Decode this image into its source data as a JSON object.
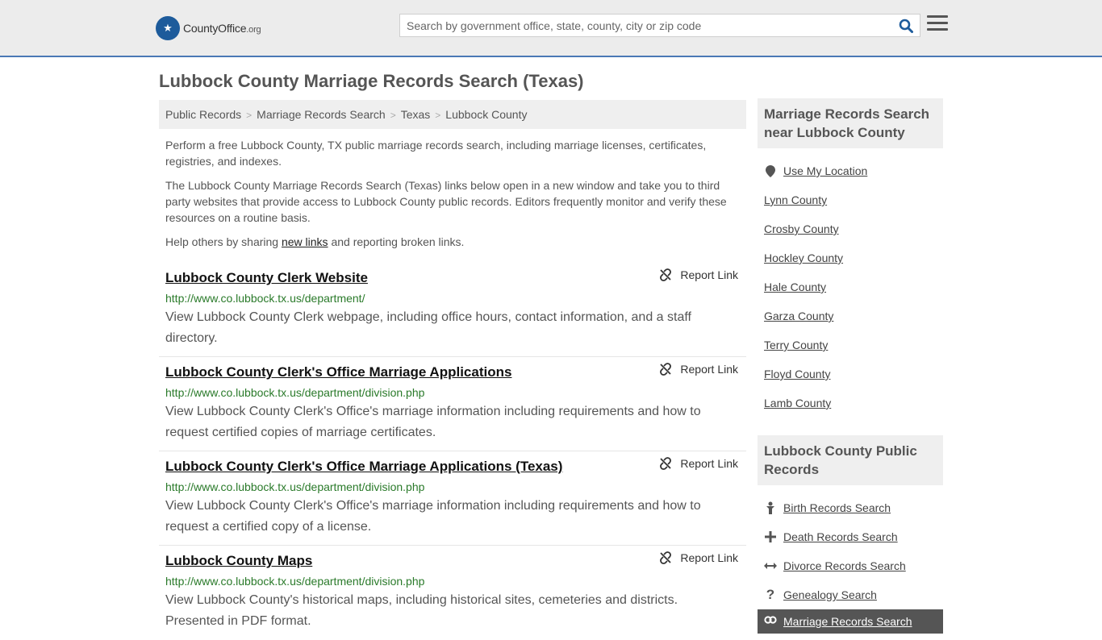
{
  "header": {
    "logo": {
      "name_part1": "County",
      "name_part2": "Office",
      "name_part3": ".org"
    },
    "search_placeholder": "Search by government office, state, county, city or zip code"
  },
  "page_title": "Lubbock County Marriage Records Search (Texas)",
  "breadcrumb": [
    "Public Records",
    "Marriage Records Search",
    "Texas",
    "Lubbock County"
  ],
  "intro": {
    "p1": "Perform a free Lubbock County, TX public marriage records search, including marriage licenses, certificates, registries, and indexes.",
    "p2": "The Lubbock County Marriage Records Search (Texas) links below open in a new window and take you to third party websites that provide access to Lubbock County public records. Editors frequently monitor and verify these resources on a routine basis.",
    "p3_before": "Help others by sharing ",
    "p3_link": "new links",
    "p3_after": " and reporting broken links."
  },
  "report_label": "Report Link",
  "links": [
    {
      "title": "Lubbock County Clerk Website",
      "url": "http://www.co.lubbock.tx.us/department/",
      "desc": "View Lubbock County Clerk webpage, including office hours, contact information, and a staff directory."
    },
    {
      "title": "Lubbock County Clerk's Office Marriage Applications",
      "url": "http://www.co.lubbock.tx.us/department/division.php",
      "desc": "View Lubbock County Clerk's Office's marriage information including requirements and how to request certified copies of marriage certificates."
    },
    {
      "title": "Lubbock County Clerk's Office Marriage Applications (Texas)",
      "url": "http://www.co.lubbock.tx.us/department/division.php",
      "desc": "View Lubbock County Clerk's Office's marriage information including requirements and how to request a certified copy of a license."
    },
    {
      "title": "Lubbock County Maps",
      "url": "http://www.co.lubbock.tx.us/department/division.php",
      "desc": "View Lubbock County's historical maps, including historical sites, cemeteries and districts. Presented in PDF format."
    }
  ],
  "sidebar": {
    "nearby_heading": "Marriage Records Search near Lubbock County",
    "use_location": "Use My Location",
    "nearby": [
      "Lynn County",
      "Crosby County",
      "Hockley County",
      "Hale County",
      "Garza County",
      "Terry County",
      "Floyd County",
      "Lamb County"
    ],
    "public_heading": "Lubbock County Public Records",
    "public_records": [
      {
        "label": "Birth Records Search",
        "icon": "birth-icon"
      },
      {
        "label": "Death Records Search",
        "icon": "cross-icon"
      },
      {
        "label": "Divorce Records Search",
        "icon": "arrows-icon"
      },
      {
        "label": "Genealogy Search",
        "icon": "question-icon"
      },
      {
        "label": "Marriage Records Search",
        "icon": "rings-icon"
      }
    ]
  }
}
